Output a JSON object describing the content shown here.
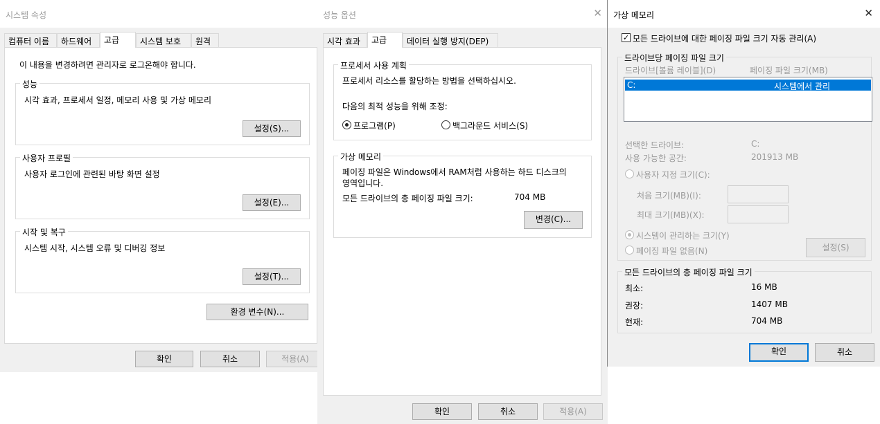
{
  "system_properties": {
    "title": "시스템 속성",
    "tabs": [
      "컴퓨터 이름",
      "하드웨어",
      "고급",
      "시스템 보호",
      "원격"
    ],
    "admin_note": "이 내용을 변경하려면 관리자로 로그온해야 합니다.",
    "performance": {
      "label": "성능",
      "desc": "시각 효과, 프로세서 일정, 메모리 사용 및 가상 메모리",
      "button": "설정(S)..."
    },
    "user_profiles": {
      "label": "사용자 프로필",
      "desc": "사용자 로그인에 관련된 바탕 화면 설정",
      "button": "설정(E)..."
    },
    "startup_recovery": {
      "label": "시작 및 복구",
      "desc": "시스템 시작, 시스템 오류 및 디버깅 정보",
      "button": "설정(T)..."
    },
    "env_button": "환경 변수(N)...",
    "ok": "확인",
    "cancel": "취소",
    "apply": "적용(A)"
  },
  "performance_options": {
    "title": "성능 옵션",
    "tabs": [
      "시각 효과",
      "고급",
      "데이터 실행 방지(DEP)"
    ],
    "processor": {
      "label": "프로세서 사용 계획",
      "desc": "프로세서 리소스를 할당하는 방법을 선택하십시오.",
      "adjust": "다음의 최적 성능을 위해 조정:",
      "programs": "프로그램(P)",
      "background": "백그라운드 서비스(S)"
    },
    "virtual_memory": {
      "label": "가상 메모리",
      "desc_line1": "페이징 파일은 Windows에서 RAM처럼 사용하는 하드 디스크의",
      "desc_line2": "영역입니다.",
      "total_label": "모든 드라이브의 총 페이징 파일 크기:",
      "total_value": "704 MB",
      "change_button": "변경(C)..."
    },
    "ok": "확인",
    "cancel": "취소",
    "apply": "적용(A)"
  },
  "virtual_memory_dialog": {
    "title": "가상 메모리",
    "auto_manage": "모든 드라이브에 대한 페이징 파일 크기 자동 관리(A)",
    "per_drive_label": "드라이브당 페이징 파일 크기",
    "col_drive": "드라이브[볼륨 레이블](D)",
    "col_size": "페이징 파일 크기(MB)",
    "row_drive": "C:",
    "row_size": "시스템에서 관리",
    "selected_drive_label": "선택한 드라이브:",
    "selected_drive_value": "C:",
    "available_label": "사용 가능한 공간:",
    "available_value": "201913 MB",
    "custom_size": "사용자 지정 크기(C):",
    "initial_size": "처음 크기(MB)(I):",
    "max_size": "최대 크기(MB)(X):",
    "system_managed": "시스템이 관리하는 크기(Y)",
    "no_paging": "페이징 파일 없음(N)",
    "set_button": "설정(S)",
    "total_label": "모든 드라이브의 총 페이징 파일 크기",
    "min_label": "최소:",
    "min_value": "16 MB",
    "recommended_label": "권장:",
    "recommended_value": "1407 MB",
    "current_label": "현재:",
    "current_value": "704 MB",
    "ok": "확인",
    "cancel": "취소"
  }
}
